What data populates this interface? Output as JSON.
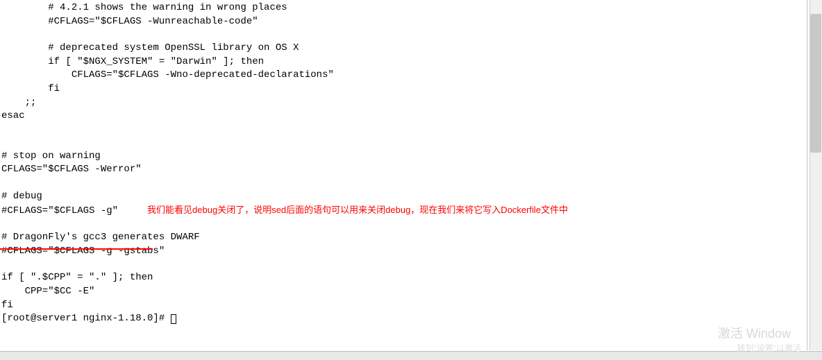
{
  "code": {
    "line1": "        # 4.2.1 shows the warning in wrong places",
    "line2": "        #CFLAGS=\"$CFLAGS -Wunreachable-code\"",
    "line3": "",
    "line4": "        # deprecated system OpenSSL library on OS X",
    "line5": "        if [ \"$NGX_SYSTEM\" = \"Darwin\" ]; then",
    "line6": "            CFLAGS=\"$CFLAGS -Wno-deprecated-declarations\"",
    "line7": "        fi",
    "line8": "    ;;",
    "line9": "esac",
    "line10": "",
    "line11": "",
    "line12": "# stop on warning",
    "line13": "CFLAGS=\"$CFLAGS -Werror\"",
    "line14": "",
    "line15": "# debug",
    "line16": "#CFLAGS=\"$CFLAGS -g\"",
    "line17": "",
    "line18": "# DragonFly's gcc3 generates DWARF",
    "line19": "#CFLAGS=\"$CFLAGS -g -gstabs\"",
    "line20": "",
    "line21": "if [ \".$CPP\" = \".\" ]; then",
    "line22": "    CPP=\"$CC -E\"",
    "line23": "fi",
    "prompt": "[root@server1 nginx-1.18.0]# "
  },
  "annotation": {
    "text": "我们能看见debug关闭了，说明sed后面的语句可以用来关闭debug，现在我们来将它写入Dockerfile文件中",
    "spacer": "     "
  },
  "watermark": {
    "line1": "激活 Window",
    "line2": "转到\"设置\"以激活"
  }
}
